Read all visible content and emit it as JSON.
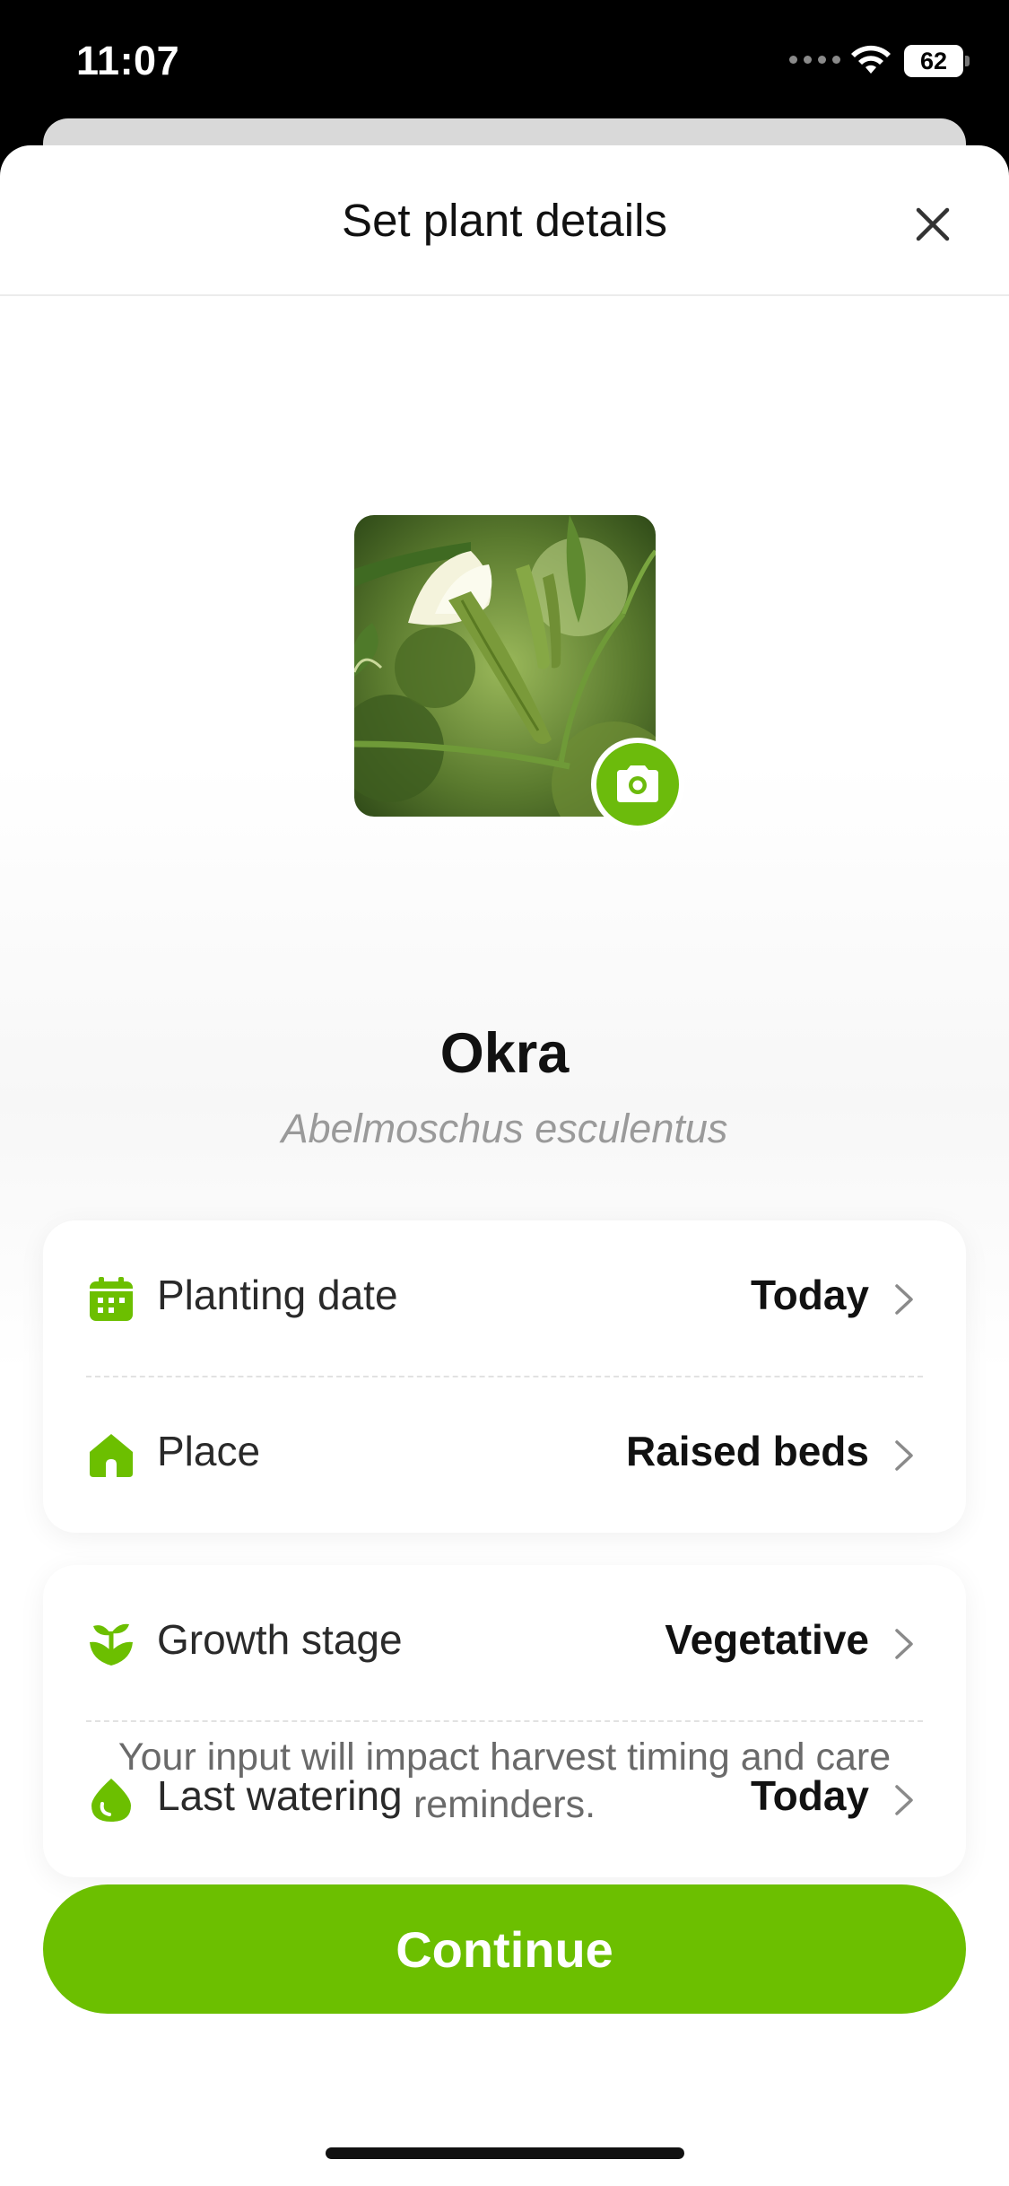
{
  "status_bar": {
    "time": "11:07",
    "battery": "62",
    "wifi_icon": "wifi-icon",
    "battery_icon": "battery-icon"
  },
  "header": {
    "title": "Set plant details",
    "close_icon": "close-icon"
  },
  "plant": {
    "name": "Okra",
    "latin_name": "Abelmoschus esculentus",
    "photo": "okra-plant-photo",
    "camera_icon": "camera-icon"
  },
  "details": {
    "group1": [
      {
        "icon": "calendar-icon",
        "label": "Planting date",
        "value": "Today"
      },
      {
        "icon": "house-icon",
        "label": "Place",
        "value": "Raised beds"
      }
    ],
    "group2": [
      {
        "icon": "sprout-icon",
        "label": "Growth stage",
        "value": "Vegetative"
      },
      {
        "icon": "water-drop-icon",
        "label": "Last watering",
        "value": "Today"
      }
    ]
  },
  "info_text": "Your input will impact harvest timing and care reminders.",
  "continue_label": "Continue",
  "colors": {
    "accent": "#6cbf00",
    "text": "#111111",
    "muted": "#9a9a9a"
  }
}
